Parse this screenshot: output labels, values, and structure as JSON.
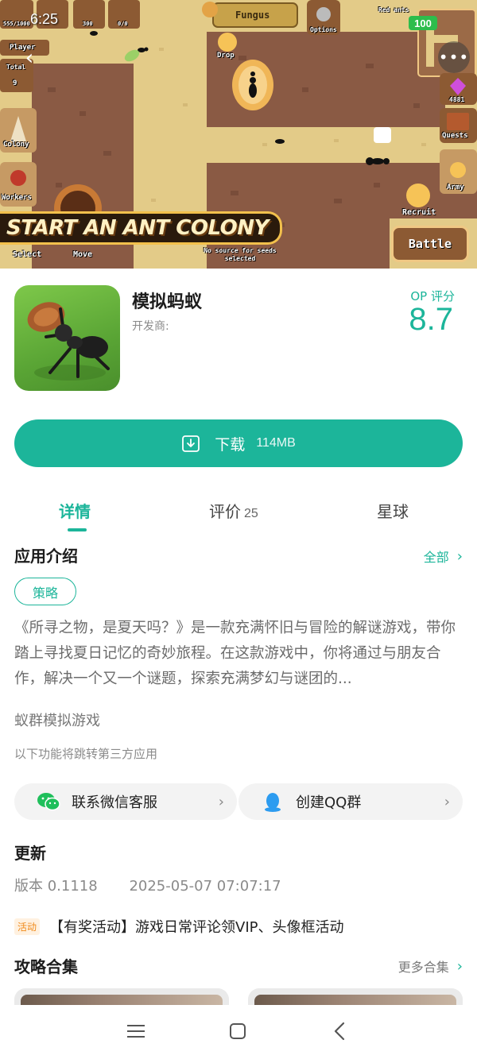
{
  "status_bar": {
    "time": "6:25",
    "battery": "100"
  },
  "hero": {
    "banner": "START AN ANT COLONY",
    "resource_counts": [
      "555/1000",
      "300",
      "0/0"
    ],
    "top_label": "Fungus",
    "options_label": "Options",
    "player_label": "Player",
    "total_label": "Total",
    "total_value": "9",
    "drop_label": "Drop",
    "colony_label": "Colony",
    "workers_label": "Workers",
    "select_label": "Select",
    "move_label": "Move",
    "no_source_text": "No source for seeds selected",
    "red_ants_label": "Red ants",
    "gems_value": "4881",
    "quests_label": "Quests",
    "army_label": "Army",
    "recruit_label": "Recruit",
    "battle_label": "Battle",
    "back_icon": "chevron-left-icon",
    "more_icon": "more-icon"
  },
  "app": {
    "name": "模拟蚂蚁",
    "developer_label": "开发商:",
    "score_label": "OP 评分",
    "score_value": "8.7"
  },
  "download": {
    "label": "下载",
    "size": "114MB"
  },
  "tabs": [
    {
      "label": "详情",
      "count": ""
    },
    {
      "label": "评价",
      "count": "25"
    },
    {
      "label": "星球",
      "count": ""
    }
  ],
  "intro": {
    "title": "应用介绍",
    "see_all": "全部",
    "tag": "策略",
    "description": "《所寻之物，是夏天吗？》是一款充满怀旧与冒险的解谜游戏，带你踏上寻找夏日记忆的奇妙旅程。在这款游戏中，你将通过与朋友合作，解决一个又一个谜题，探索充满梦幻与谜团的...",
    "subtitle": "蚁群模拟游戏",
    "third_party_hint": "以下功能将跳转第三方应用"
  },
  "external": [
    {
      "label": "联系微信客服",
      "icon": "wechat-icon"
    },
    {
      "label": "创建QQ群",
      "icon": "qq-icon"
    }
  ],
  "update": {
    "title": "更新",
    "version": "版本 0.1118",
    "date": "2025-05-07 07:07:17",
    "activity_badge": "活动",
    "activity_text": "【有奖活动】游戏日常评论领VIP、头像框活动"
  },
  "guides": {
    "title": "攻略合集",
    "more": "更多合集"
  },
  "colors": {
    "accent": "#1cb59a",
    "text": "#222222",
    "muted": "#8a8a8a"
  }
}
